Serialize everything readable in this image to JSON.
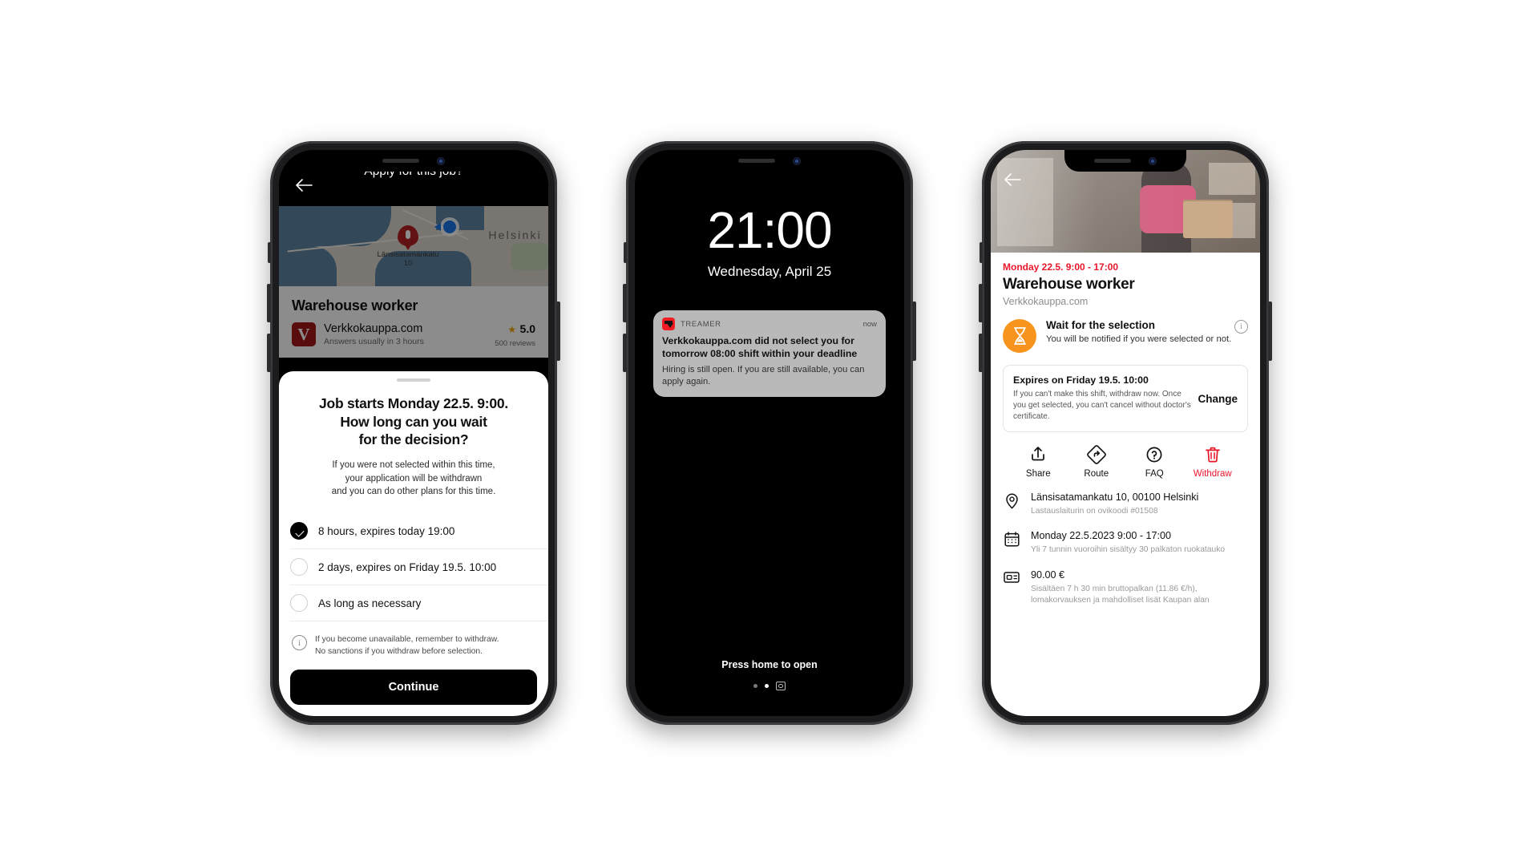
{
  "phone1": {
    "nav": {
      "back_icon": "arrow-left-icon",
      "title": "Apply for this job?"
    },
    "map": {
      "pin_label": "Länsisatamankatu\n10",
      "city": "Helsinki"
    },
    "job": {
      "title": "Warehouse worker",
      "company": "Verkkokauppa.com",
      "logo_letter": "V",
      "answers": "Answers usually in 3 hours",
      "rating": "5.0",
      "star": "★",
      "reviews": "500 reviews"
    },
    "sheet": {
      "heading_line1": "Job starts Monday 22.5. 9:00.",
      "heading_line2": "How long can you wait",
      "heading_line3": "for the decision?",
      "desc_line1": "If you were not selected within this time,",
      "desc_line2": "your application will be withdrawn",
      "desc_line3": "and you can do other plans for this time.",
      "options": [
        {
          "label": "8 hours, expires today 19:00",
          "selected": true
        },
        {
          "label": "2 days, expires on Friday 19.5. 10:00",
          "selected": false
        },
        {
          "label": "As long as necessary",
          "selected": false
        }
      ],
      "note_line1": "If you become unavailable, remember to withdraw.",
      "note_line2": "No sanctions if you withdraw before selection.",
      "note_icon": "info-icon",
      "continue_label": "Continue"
    }
  },
  "phone2": {
    "time": "21:00",
    "date": "Wednesday, April 25",
    "notification": {
      "app": "TREAMER",
      "timestamp": "now",
      "title_line1": "Verkkokauppa.com did not select you for",
      "title_line2": "tomorrow 08:00 shift within your deadline",
      "body_line1": "Hiring is still open. If you are still available, you can",
      "body_line2": "apply again."
    },
    "footer": {
      "press_home": "Press home to open"
    }
  },
  "phone3": {
    "back_icon": "arrow-left-icon",
    "date": "Monday 22.5.  9:00 - 17:00",
    "title": "Warehouse worker",
    "company": "Verkkokauppa.com",
    "status": {
      "icon": "hourglass-icon",
      "heading": "Wait for the selection",
      "body": "You will be notified if you were selected or not.",
      "info_icon": "info-icon"
    },
    "expire_card": {
      "heading": "Expires on Friday 19.5. 10:00",
      "body": "If you can't make this shift, withdraw now. Once you get selected, you can't cancel without doctor's certificate.",
      "change_label": "Change"
    },
    "actions": [
      {
        "label": "Share",
        "icon": "share-icon",
        "accent": "#111111"
      },
      {
        "label": "Route",
        "icon": "route-icon",
        "accent": "#111111"
      },
      {
        "label": "FAQ",
        "icon": "question-icon",
        "accent": "#111111"
      },
      {
        "label": "Withdraw",
        "icon": "trash-icon",
        "accent": "#e8162a"
      }
    ],
    "details": [
      {
        "icon": "location-pin-icon",
        "title": "Länsisatamankatu 10, 00100 Helsinki",
        "subtitle": "Lastauslaiturin on ovikoodi #01508"
      },
      {
        "icon": "calendar-icon",
        "title": "Monday 22.5.2023   9:00 - 17:00",
        "subtitle": "Yli 7 tunnin vuoroihin sisältyy 30 palkaton ruokatauko"
      },
      {
        "icon": "money-icon",
        "title": "90.00 €",
        "subtitle": "Sisältäen 7 h 30 min bruttopalkan (11.86 €/h), lomakorvauksen ja mahdolliset lisät Kaupan alan"
      }
    ]
  }
}
